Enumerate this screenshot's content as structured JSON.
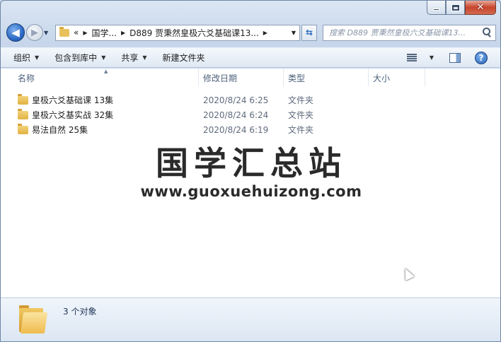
{
  "window": {
    "caption_buttons": {
      "minimize": "minimize",
      "maximize": "maximize",
      "close": "✕"
    }
  },
  "navigation": {
    "back_glyph": "◀",
    "forward_glyph": "▶",
    "address": {
      "overflow": "«",
      "crumbs": [
        "国学...",
        "D889 贾秉然皇极六爻基础课13..."
      ]
    },
    "search": {
      "placeholder": "搜索 D889 贾秉然皇极六爻基础课13..."
    }
  },
  "toolbar": {
    "organize": "组织",
    "include_library": "包含到库中",
    "share": "共享",
    "new_folder": "新建文件夹"
  },
  "columns": {
    "name": "名称",
    "date": "修改日期",
    "type": "类型",
    "size": "大小"
  },
  "files": [
    {
      "name": "皇极六爻基础课 13集",
      "date": "2020/8/24 6:25",
      "type": "文件夹"
    },
    {
      "name": "皇极六爻基实战 32集",
      "date": "2020/8/24 6:24",
      "type": "文件夹"
    },
    {
      "name": "易法自然 25集",
      "date": "2020/8/24 6:19",
      "type": "文件夹"
    }
  ],
  "watermark": {
    "title": "国学汇总站",
    "url": "www.guoxuehuizong.com"
  },
  "details": {
    "count": "3 个对象"
  },
  "colors": {
    "accent": "#2c6ac5",
    "folder": "#e2b244",
    "chrome": "#c7d6ea"
  }
}
